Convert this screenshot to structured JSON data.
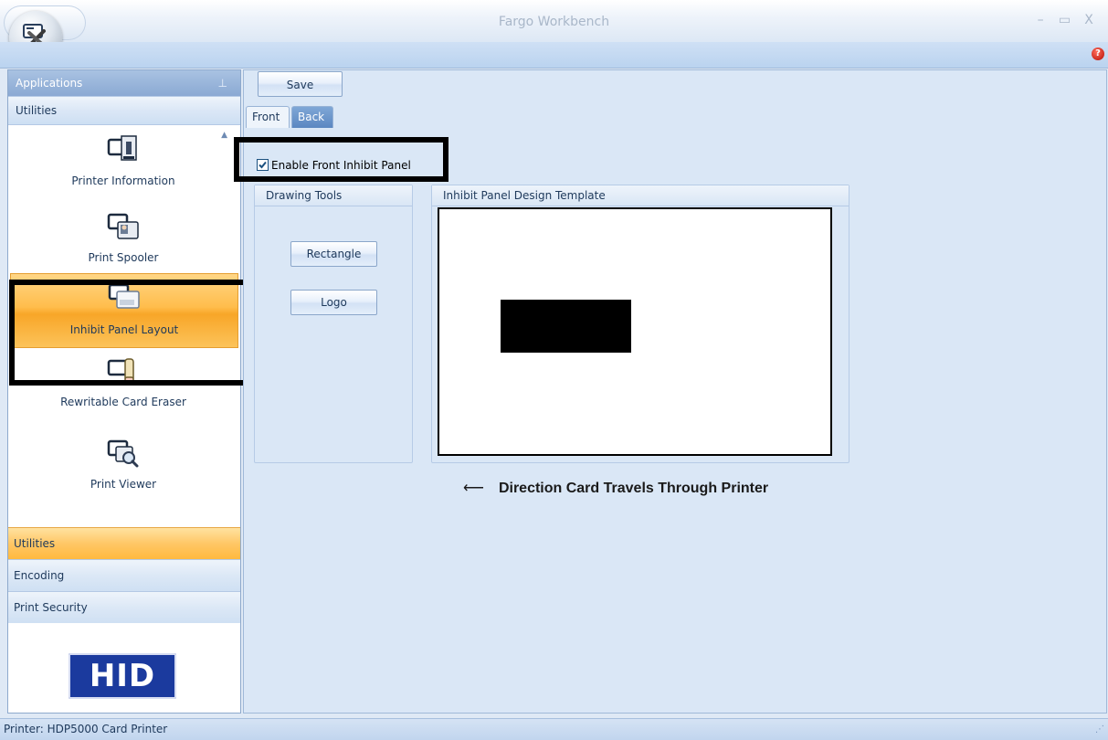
{
  "window": {
    "title": "Fargo Workbench",
    "controls": {
      "minimize": "–",
      "maximize": "▭",
      "close": "X"
    },
    "help": "?"
  },
  "sidebar": {
    "header": "Applications",
    "pin": "ᵖ",
    "group": "Utilities",
    "items": [
      {
        "label": "Printer Information",
        "icon": "printer-information-icon"
      },
      {
        "label": "Print Spooler",
        "icon": "print-spooler-icon"
      },
      {
        "label": "Inhibit Panel Layout",
        "icon": "inhibit-panel-layout-icon",
        "active": true
      },
      {
        "label": "Rewritable Card Eraser",
        "icon": "rewritable-card-eraser-icon"
      },
      {
        "label": "Print Viewer",
        "icon": "print-viewer-icon"
      }
    ],
    "categories": [
      {
        "label": "Utilities",
        "active": true
      },
      {
        "label": "Encoding",
        "active": false
      },
      {
        "label": "Print Security",
        "active": false
      }
    ],
    "logo": "HID"
  },
  "toolbar": {
    "save_label": "Save"
  },
  "tabs": [
    {
      "label": "Front",
      "active": true
    },
    {
      "label": "Back",
      "active": false
    }
  ],
  "front": {
    "enable_label": "Enable Front Inhibit Panel",
    "enable_checked": true,
    "drawing_tools": {
      "title": "Drawing Tools",
      "buttons": [
        "Rectangle",
        "Logo"
      ]
    },
    "template": {
      "title": "Inhibit Panel Design Template"
    },
    "arrow": "⟵",
    "direction_text": "Direction Card Travels Through Printer"
  },
  "status": {
    "text": "Printer:  HDP5000 Card Printer"
  },
  "colors": {
    "accent_orange": "#ffbd4c",
    "ribbon_blue": "#bad3ef",
    "hid_blue": "#1b3a9e"
  }
}
